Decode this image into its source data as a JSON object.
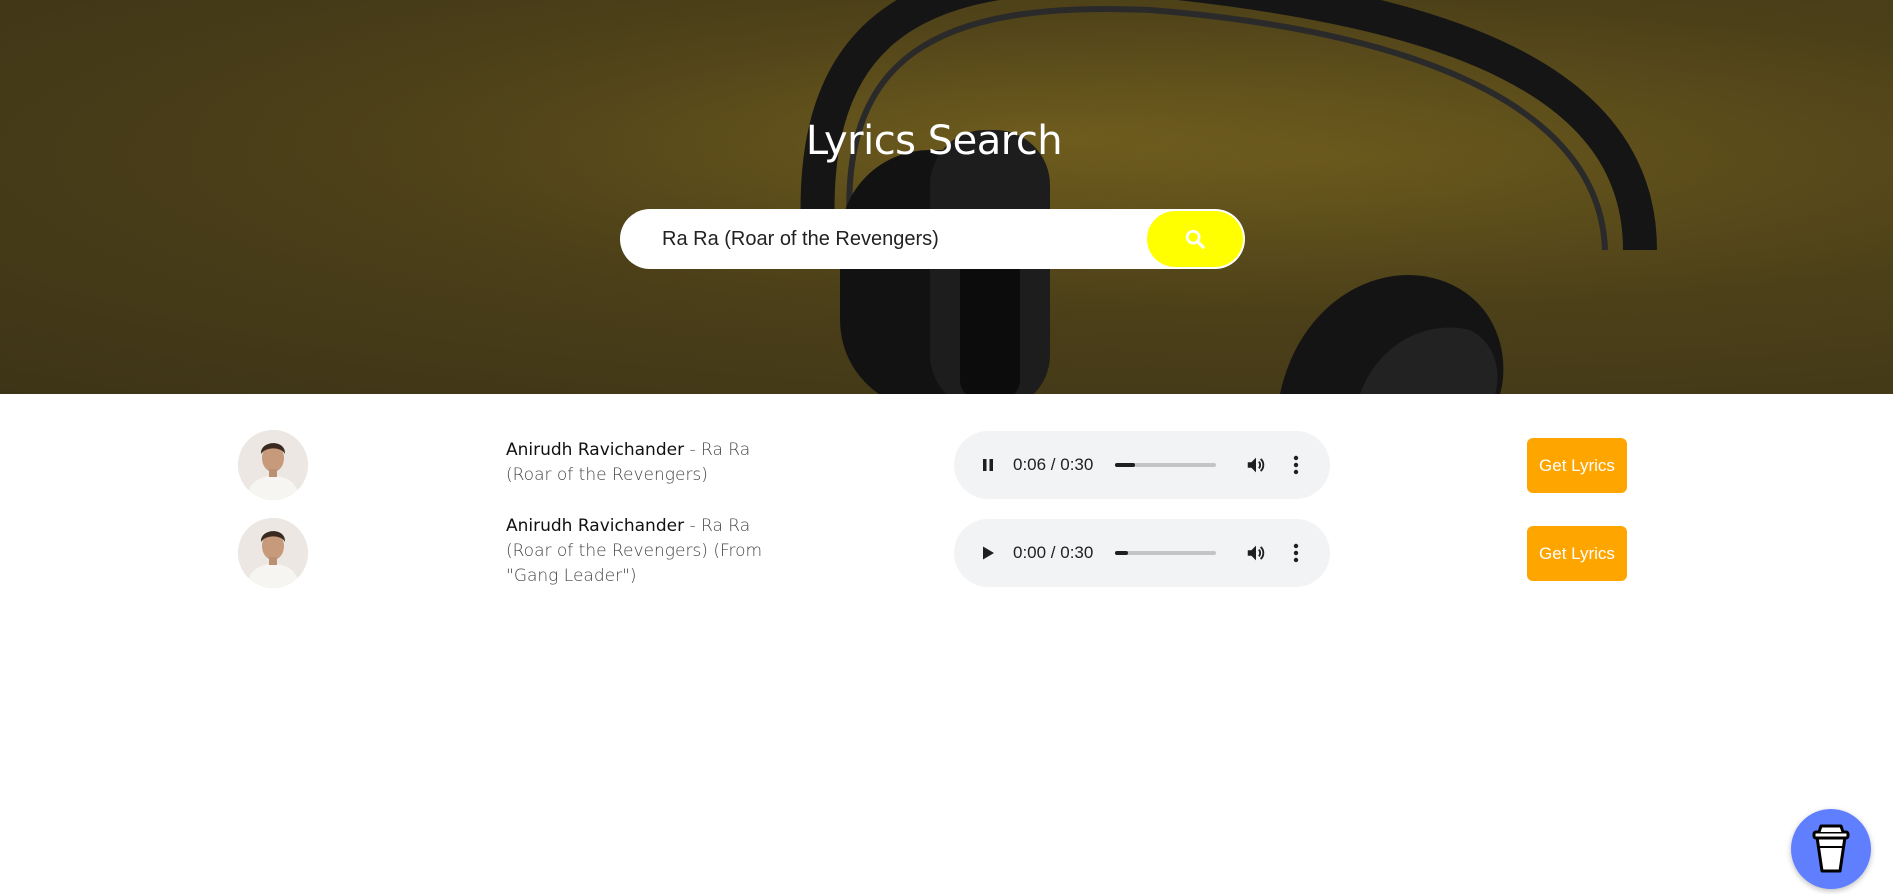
{
  "colors": {
    "hero_tint": "#4d4119",
    "search_button": "#ffff00",
    "lyrics_button": "#ffa500",
    "player_bg": "#f1f3f4",
    "coffee_button": "#5f7fff"
  },
  "header": {
    "title": "Lyrics Search"
  },
  "search": {
    "value": "Ra Ra (Roar of the Revengers)",
    "button_icon": "search-icon"
  },
  "results": [
    {
      "artist": "Anirudh Ravichander",
      "separator": " - ",
      "title": "Ra Ra (Roar of the Revengers)",
      "player": {
        "state": "playing",
        "state_icon": "pause-icon",
        "time": "0:06 / 0:30",
        "progress": 0.2
      },
      "button": "Get Lyrics"
    },
    {
      "artist": "Anirudh Ravichander",
      "separator": " - ",
      "title": "Ra Ra (Roar of the Revengers) (From \"Gang Leader\")",
      "player": {
        "state": "paused",
        "state_icon": "play-icon",
        "time": "0:00 / 0:30",
        "progress": 0.0
      },
      "button": "Get Lyrics"
    }
  ],
  "floating": {
    "icon": "coffee-cup-icon"
  }
}
